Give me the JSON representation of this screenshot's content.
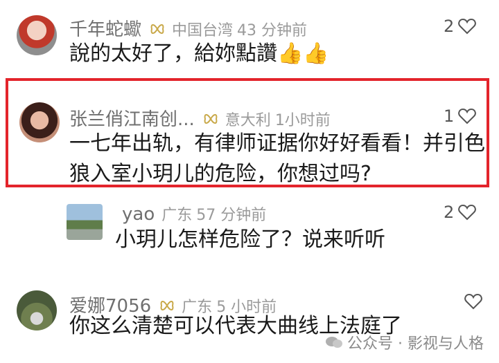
{
  "comments": [
    {
      "name": "千年蛇蠍",
      "location": "中国台湾",
      "time": "43 分钟前",
      "text_lines": [
        "說的太好了，給妳點讚"
      ],
      "emoji": "👍👍",
      "likes": "2"
    },
    {
      "name": "张兰俏江南创...",
      "location": "意大利",
      "time": "1小时前",
      "text_lines": [
        "一七年出轨，有律师证据你好好看看！并引色",
        "狼入室小玥儿的危险，你想过吗?"
      ],
      "likes": "1"
    },
    {
      "name": "yao",
      "location": "广东",
      "time": "57 分钟前",
      "text_lines": [
        "小玥儿怎样危险了？说来听听"
      ],
      "likes": "2"
    },
    {
      "name": "爱娜7056",
      "location": "广东",
      "time": "5 小时前",
      "text_lines": [
        "你这么清楚可以代表大曲线上法庭了"
      ],
      "likes": ""
    }
  ],
  "watermark": "公众号 · 影视与人格",
  "colors": {
    "highlight": "#e3242b",
    "badge": "#c9a94a"
  }
}
